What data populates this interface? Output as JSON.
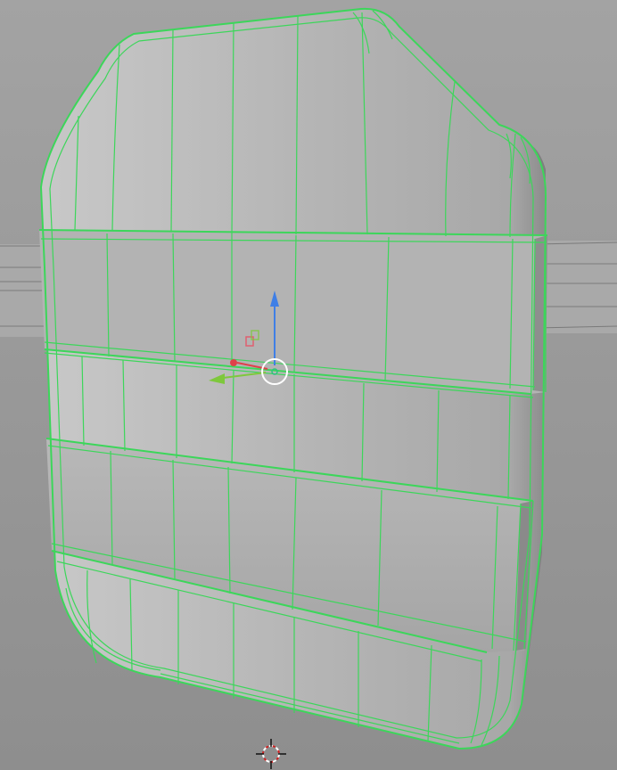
{
  "viewport": {
    "mode": "edit-mode-wireframe-overlay",
    "background_color": "#909090",
    "object": {
      "kind": "plate-mesh",
      "selected": true,
      "wire_color": "#3cd65a",
      "face_color": "#b9b9b9"
    },
    "gizmo": {
      "axis_colors": {
        "x": "#e0404a",
        "y": "#7ec83c",
        "z": "#3f7fe6"
      },
      "pivot_color": "#ffffff"
    },
    "icons": [
      "transform-gizmo-icon",
      "3d-cursor-icon"
    ]
  }
}
